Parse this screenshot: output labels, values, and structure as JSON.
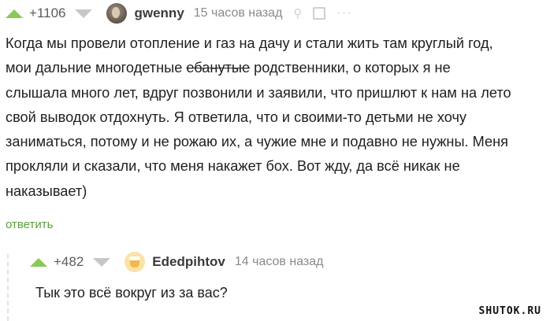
{
  "comment1": {
    "score": "+1106",
    "author": "gwenny",
    "time": "15 часов назад",
    "lines": [
      {
        "text": "Когда мы провели отопление и газ на дачу и стали жить там круглый год,"
      },
      {
        "pre": "мои дальние многодетные ",
        "strike": "ебанутые",
        "post": " родственники, о которых я не"
      },
      {
        "text": "слышала много лет, вдруг позвонили и заявили, что пришлют к нам на лето"
      },
      {
        "text": "свой выводок отдохнуть. Я ответила, что и своими-то детьми не хочу"
      },
      {
        "text": "заниматься, потому и не рожаю их, а чужие мне и подавно не нужны. Меня"
      },
      {
        "text": "прокляли и сказали, что меня накажет бох. Вот жду, да всё никак не"
      },
      {
        "text": "наказывает)"
      }
    ],
    "reply_label": "ответить"
  },
  "comment2": {
    "score": "+482",
    "author": "Ededpihtov",
    "time": "14 часов назад",
    "text": "Тык это всё вокруг из за вас?"
  },
  "watermark": "SHUTOK.RU",
  "colors": {
    "upvote": "#8ac858",
    "downvote": "#c7c7c7",
    "reply": "#5aa03a"
  }
}
